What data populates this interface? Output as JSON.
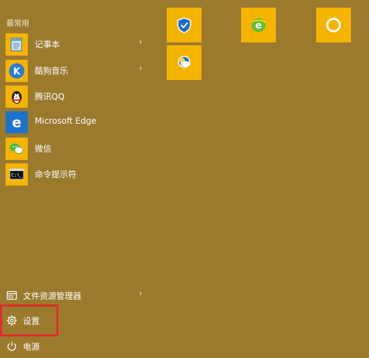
{
  "start_menu": {
    "section_header": "最常用",
    "apps": [
      {
        "label": "记事本",
        "icon": "notepad-icon",
        "has_submenu": true
      },
      {
        "label": "酷狗音乐",
        "icon": "kugou-music-icon",
        "has_submenu": true
      },
      {
        "label": "腾讯QQ",
        "icon": "qq-penguin-icon",
        "has_submenu": false
      },
      {
        "label": "Microsoft Edge",
        "icon": "edge-icon",
        "has_submenu": false
      },
      {
        "label": "微信",
        "icon": "wechat-icon",
        "has_submenu": false
      },
      {
        "label": "命令提示符",
        "icon": "command-prompt-icon",
        "has_submenu": false
      }
    ],
    "bottom": {
      "explorer_label": "文件资源管理器",
      "settings_label": "设置",
      "power_label": "电源"
    },
    "tiles": [
      {
        "icon": "shield-check-icon"
      },
      {
        "icon": "green-e-browser-icon"
      },
      {
        "icon": "cortana-ring-icon"
      },
      {
        "icon": "weather-sun-cloud-icon"
      }
    ],
    "colors": {
      "background": "#9b7a2e",
      "tile": "#f5b400",
      "highlight": "#e32b2b"
    }
  }
}
